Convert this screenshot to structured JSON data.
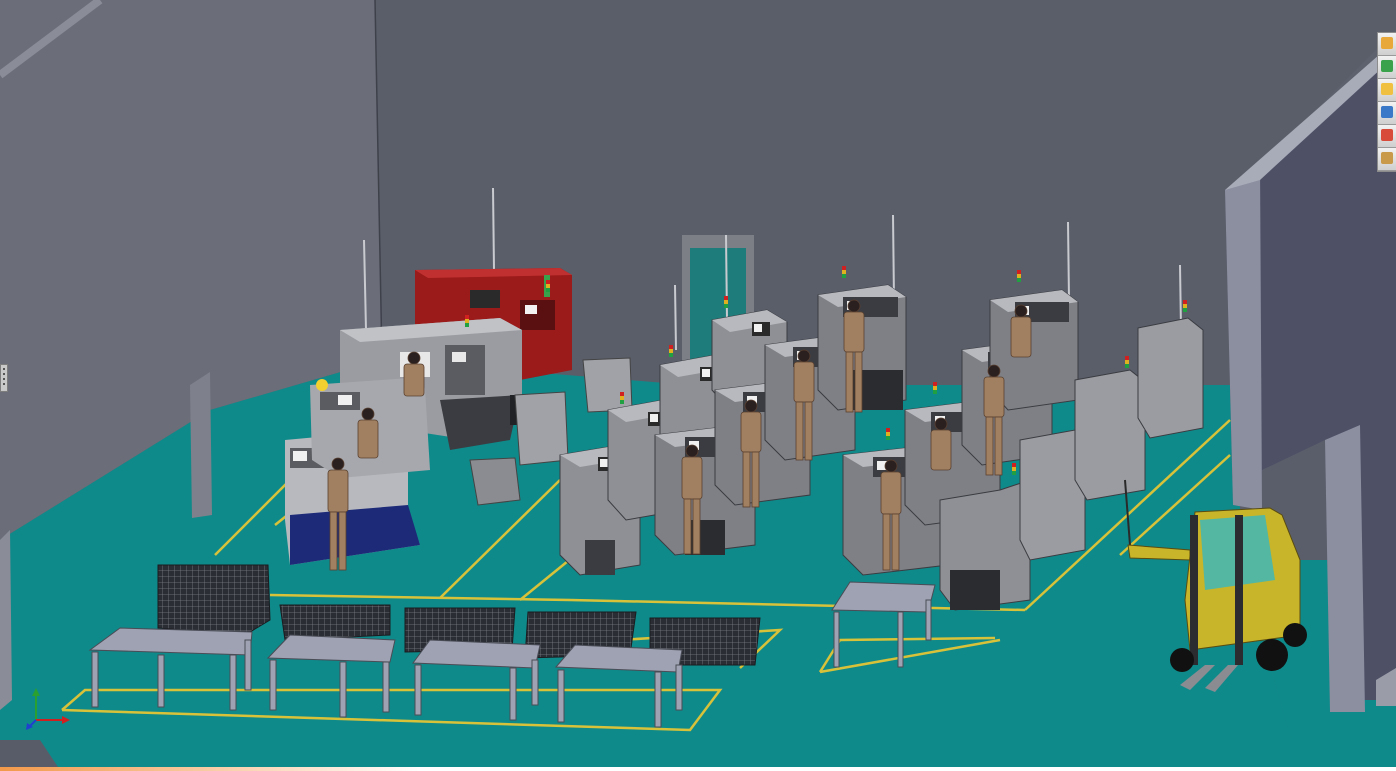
{
  "taskpane": {
    "buttons": [
      {
        "name": "solidworks-resources-icon",
        "color": "#e8a93a"
      },
      {
        "name": "design-library-icon",
        "color": "#3aa24a"
      },
      {
        "name": "file-explorer-icon",
        "color": "#f0c040"
      },
      {
        "name": "view-palette-icon",
        "color": "#3a78c8"
      },
      {
        "name": "appearances-scenes-icon",
        "color": "#d84a3a"
      },
      {
        "name": "custom-properties-icon",
        "color": "#c89a4a"
      }
    ]
  },
  "colors": {
    "background": "#5b5f6b",
    "floor": "#0f8a8a",
    "floor_lines": "#d8c23a",
    "walls": "#6e717c",
    "machine_grey": "#8e9096",
    "machine_red": "#9b1a1a",
    "machine_blue": "#1c2a78",
    "forklift": "#c8b52a"
  }
}
